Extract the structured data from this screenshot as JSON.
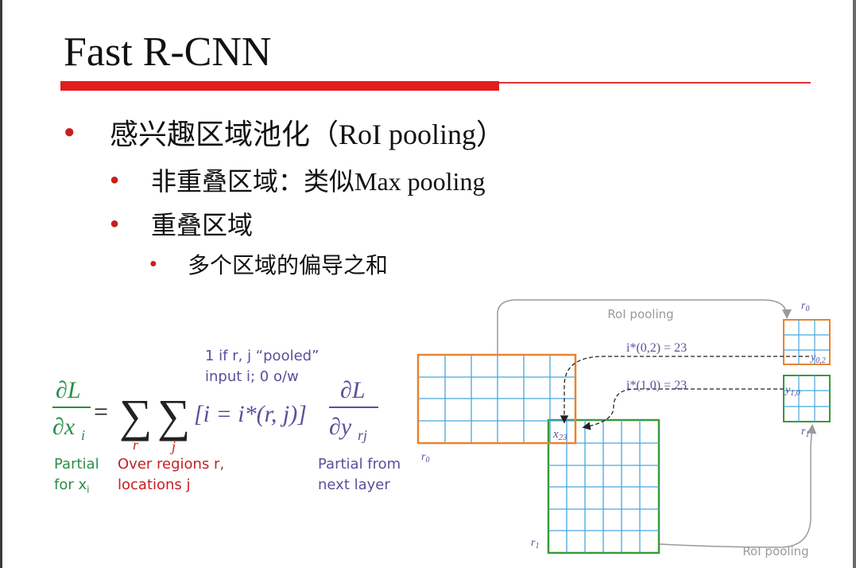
{
  "title": "Fast R-CNN",
  "bullets": {
    "level1": "感兴趣区域池化（RoI pooling）",
    "level2_a": "非重叠区域：类似Max pooling",
    "level2_b": "重叠区域",
    "level3": "多个区域的偏导之和"
  },
  "formula": {
    "annotation_pooled_line1": "1 if r, j “pooled”",
    "annotation_pooled_line2": "input i; 0 o/w",
    "label_partial_x_line1": "Partial",
    "label_partial_x_line2": "for x",
    "label_partial_x_sub": "i",
    "label_regions_line1": "Over regions r,",
    "label_regions_line2": "locations j",
    "label_partial_next_line1": "Partial from",
    "label_partial_next_line2": "next layer"
  },
  "diagram": {
    "roi_pooling_top": "RoI pooling",
    "roi_pooling_bottom": "RoI pooling",
    "eq_top": "i*(0,2) = 23",
    "eq_bottom": "i*(1,0) = 23",
    "r0_label_big": "r",
    "r0_sub": "0",
    "r1_label_big": "r",
    "r1_sub": "1",
    "out_r0": "r",
    "out_r0_sub": "0",
    "out_r1": "r",
    "out_r1_sub": "1",
    "y02": "y",
    "y02_sub": "0,2",
    "y10": "y",
    "y10_sub": "1,0",
    "x23": "x",
    "x23_sub": "23"
  },
  "colors": {
    "accent_red": "#e11d1d",
    "orange_region": "#e8842f",
    "green_region": "#3a9a3a",
    "grid_blue": "#49a6dd",
    "math_green": "#2a8f47",
    "math_red": "#c62020",
    "math_purple": "#5a4f9a",
    "diagram_gray": "#9a9a9a"
  }
}
